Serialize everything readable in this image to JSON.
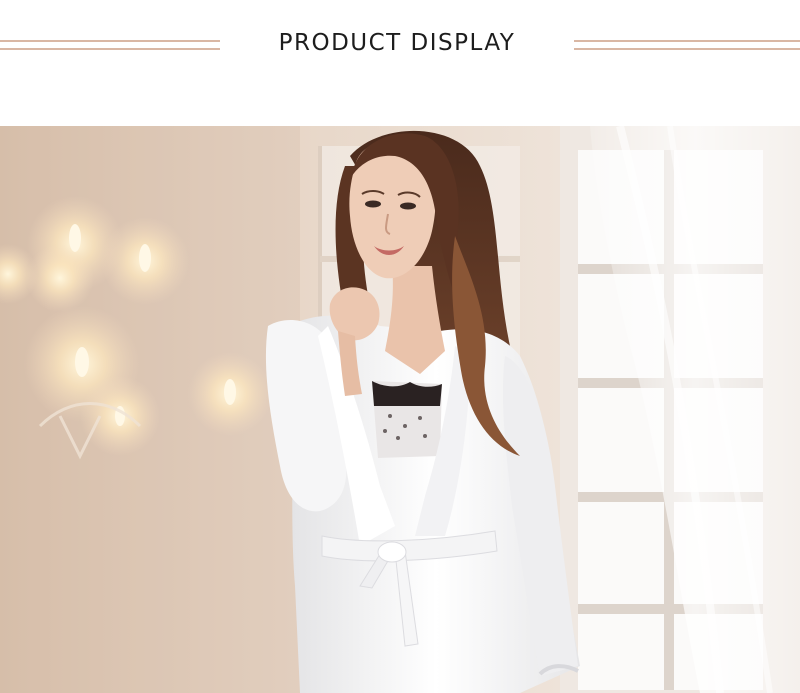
{
  "header": {
    "title": "PRODUCT DISPLAY",
    "rule_color": "#d9b7a4"
  },
  "photo": {
    "subject": "model-in-white-satin-robe",
    "background_tone": "#e8d9cc"
  }
}
